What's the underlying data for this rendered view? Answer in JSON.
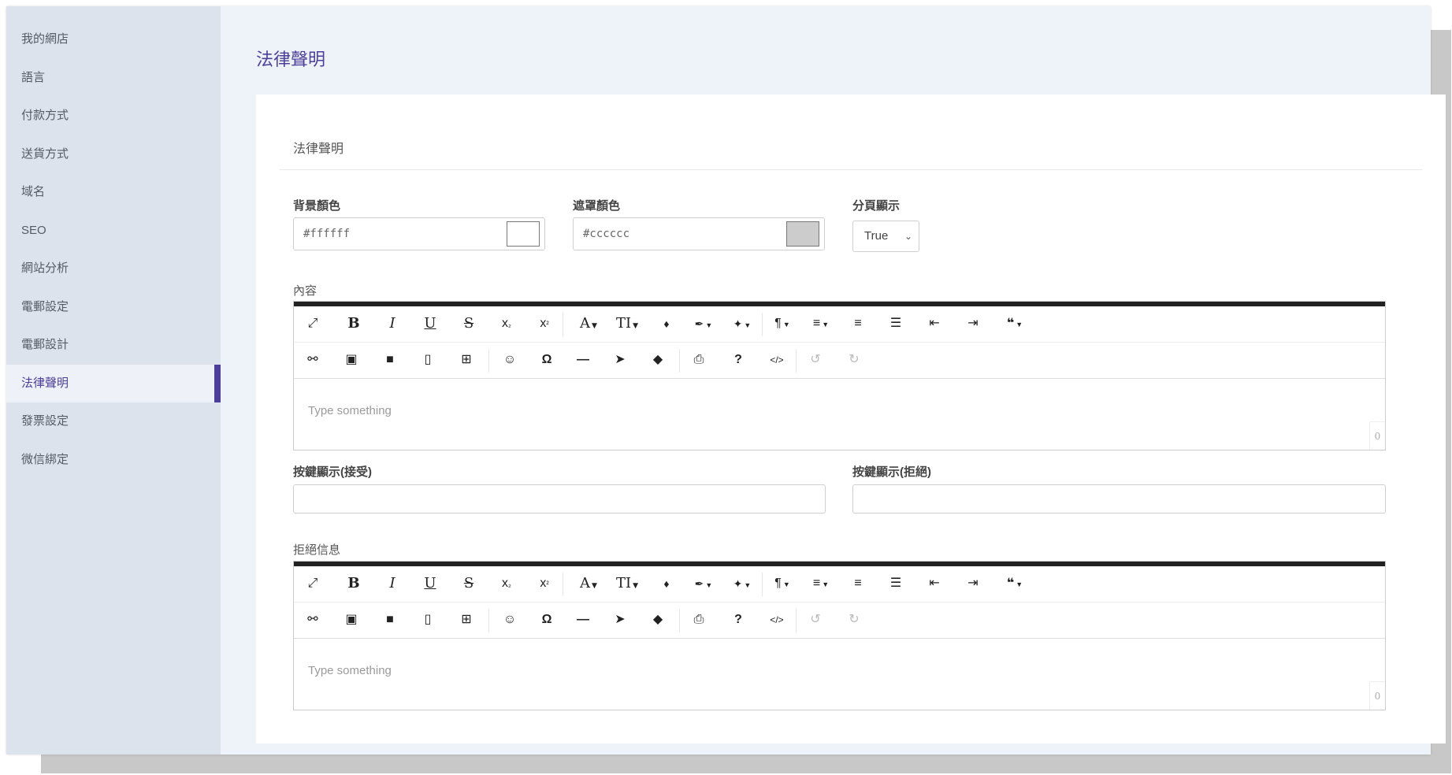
{
  "sidebar": {
    "items": [
      {
        "label": "我的網店"
      },
      {
        "label": "語言"
      },
      {
        "label": "付款方式"
      },
      {
        "label": "送貨方式"
      },
      {
        "label": "域名"
      },
      {
        "label": "SEO"
      },
      {
        "label": "網站分析"
      },
      {
        "label": "電郵設定"
      },
      {
        "label": "電郵設計"
      },
      {
        "label": "法律聲明"
      },
      {
        "label": "發票設定"
      },
      {
        "label": "微信綁定"
      }
    ],
    "active_index": 9
  },
  "page": {
    "title": "法律聲明",
    "card_title": "法律聲明"
  },
  "form": {
    "bg_color": {
      "label": "背景顏色",
      "value": "#ffffff",
      "swatch": "#ffffff"
    },
    "mask_color": {
      "label": "遮罩顏色",
      "value": "#cccccc",
      "swatch": "#cccccc"
    },
    "pagination": {
      "label": "分頁顯示",
      "value": "True"
    },
    "content_label": "內容",
    "accept_label": "按鍵顯示(接受)",
    "reject_label": "按鍵顯示(拒絕)",
    "reject_msg_label": "拒絕信息",
    "editor_placeholder": "Type something",
    "editor_count": "0"
  },
  "toolbar": {
    "row1": [
      {
        "name": "fullscreen-icon",
        "glyph": "⤢"
      },
      {
        "name": "bold-button",
        "glyph": "B"
      },
      {
        "name": "italic-button",
        "glyph": "I"
      },
      {
        "name": "underline-button",
        "glyph": "U"
      },
      {
        "name": "strikethrough-button",
        "glyph": "S"
      },
      {
        "name": "subscript-button",
        "glyph": "x₂"
      },
      {
        "name": "superscript-button",
        "glyph": "x²"
      },
      {
        "name": "font-family-button",
        "glyph": "A"
      },
      {
        "name": "font-size-button",
        "glyph": "TI"
      },
      {
        "name": "color-icon",
        "glyph": "♦"
      },
      {
        "name": "brush-icon",
        "glyph": "🖌"
      },
      {
        "name": "magic-icon",
        "glyph": "⚚"
      },
      {
        "name": "paragraph-button",
        "glyph": "¶"
      },
      {
        "name": "align-button",
        "glyph": "≡"
      },
      {
        "name": "ordered-list-icon",
        "glyph": "⒈"
      },
      {
        "name": "unordered-list-icon",
        "glyph": "☰"
      },
      {
        "name": "outdent-icon",
        "glyph": "⇤"
      },
      {
        "name": "indent-icon",
        "glyph": "⇥"
      },
      {
        "name": "quote-button",
        "glyph": "❝"
      }
    ],
    "row2": [
      {
        "name": "link-icon",
        "glyph": "∞"
      },
      {
        "name": "image-icon",
        "glyph": "▣"
      },
      {
        "name": "video-icon",
        "glyph": "■"
      },
      {
        "name": "file-icon",
        "glyph": "▯"
      },
      {
        "name": "table-icon",
        "glyph": "⊞"
      },
      {
        "name": "emoji-icon",
        "glyph": "☺"
      },
      {
        "name": "special-char-icon",
        "glyph": "Ω"
      },
      {
        "name": "horizontal-line-icon",
        "glyph": "—"
      },
      {
        "name": "select-all-icon",
        "glyph": "➤"
      },
      {
        "name": "clear-format-icon",
        "glyph": "◆"
      },
      {
        "name": "print-icon",
        "glyph": "⎙"
      },
      {
        "name": "help-icon",
        "glyph": "?"
      },
      {
        "name": "code-view-icon",
        "glyph": "</>"
      },
      {
        "name": "undo-icon",
        "glyph": "↺"
      },
      {
        "name": "redo-icon",
        "glyph": "↻"
      }
    ]
  }
}
